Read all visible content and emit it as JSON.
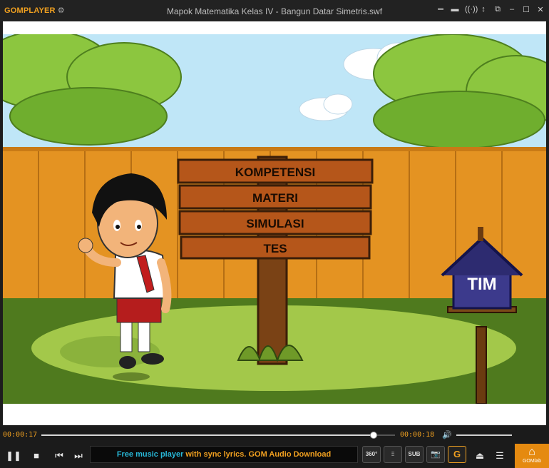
{
  "app": {
    "logo": "GOMPLAYER",
    "title": "Mapok Matematika Kelas IV - Bangun Datar Simetris.swf"
  },
  "scene": {
    "menu": [
      "KOMPETENSI",
      "MATERI",
      "SIMULASI",
      "TES"
    ],
    "birdhouse_label": "TIM"
  },
  "playback": {
    "elapsed": "00:00:17",
    "total": "00:00:18",
    "progress": 0.94,
    "volume": 1.0
  },
  "ticker": {
    "part1": "Free music player",
    "part2": " with sync lyrics. GOM Audio Download"
  },
  "buttons": {
    "vr": "360°",
    "sub": "SUB",
    "gomlab": "GOMlab"
  },
  "colors": {
    "accent": "#f0a020",
    "ticker_blue": "#28b8d8"
  }
}
